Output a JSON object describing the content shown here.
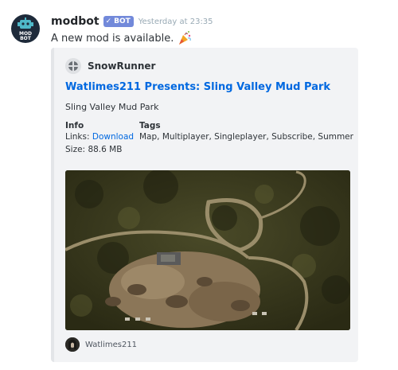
{
  "message": {
    "username": "modbot",
    "bot_tag": "BOT",
    "timestamp": "Yesterday at 23:35",
    "content": "A new mod is available.",
    "avatar_icon": "robot-icon",
    "avatar_lettering": "MOD BOT",
    "emoji_icon": "party-popper-icon"
  },
  "embed": {
    "author_name": "SnowRunner",
    "author_icon": "snowrunner-icon",
    "title": "Watlimes211 Presents: Sling Valley Mud Park",
    "description": "Sling Valley Mud Park",
    "fields": {
      "info": {
        "name": "Info",
        "links_label": "Links:",
        "links_value": "Download",
        "size_label": "Size:",
        "size_value": "88.6 MB"
      },
      "tags": {
        "name": "Tags",
        "value": "Map, Multiplayer, Singleplayer, Subscribe, Summer"
      }
    },
    "image_description": "aerial-map-screenshot",
    "footer_text": "Watlimes211",
    "footer_icon": "user-avatar-icon",
    "accent_color": "#e3e5e8",
    "link_color": "#0068e0"
  },
  "colors": {
    "bot_tag": "#7289da",
    "timestamp": "#99aab5",
    "embed_bg": "#f2f3f5"
  }
}
